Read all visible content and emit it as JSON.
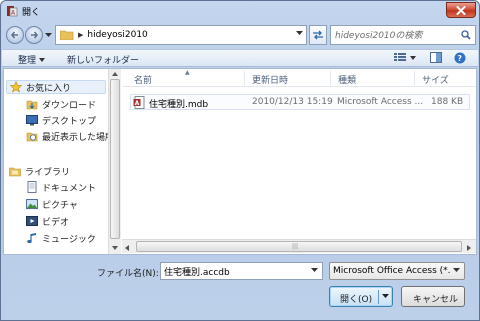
{
  "window": {
    "title": "開く"
  },
  "address": {
    "path": "hideyosi2010"
  },
  "search": {
    "placeholder": "hideyosi2010の検索"
  },
  "toolbar": {
    "organize_label": "整理",
    "new_folder_label": "新しいフォルダー"
  },
  "sidebar": {
    "favorites_label": "お気に入り",
    "favorites": [
      {
        "label": "ダウンロード",
        "icon": "download-folder-icon"
      },
      {
        "label": "デスクトップ",
        "icon": "desktop-icon"
      },
      {
        "label": "最近表示した場所",
        "icon": "recent-places-icon"
      }
    ],
    "libraries_label": "ライブラリ",
    "libraries": [
      {
        "label": "ドキュメント",
        "icon": "documents-icon"
      },
      {
        "label": "ピクチャ",
        "icon": "pictures-icon"
      },
      {
        "label": "ビデオ",
        "icon": "videos-icon"
      },
      {
        "label": "ミュージック",
        "icon": "music-icon"
      }
    ]
  },
  "columns": {
    "name": "名前",
    "modified": "更新日時",
    "type": "種類",
    "size": "サイズ"
  },
  "files": [
    {
      "name": "住宅種別.mdb",
      "modified": "2010/12/13 15:19",
      "type": "Microsoft Access ...",
      "size": "188 KB"
    }
  ],
  "bottom": {
    "filename_label": "ファイル名(N):",
    "filename_value": "住宅種別.accdb",
    "filter_value": "Microsoft Office Access (*.m",
    "open_label": "開く(O)",
    "cancel_label": "キャンセル"
  },
  "colors": {
    "titlebar": "#c4d6ee",
    "close": "#c1341d",
    "selection": "#e8f1fb"
  }
}
